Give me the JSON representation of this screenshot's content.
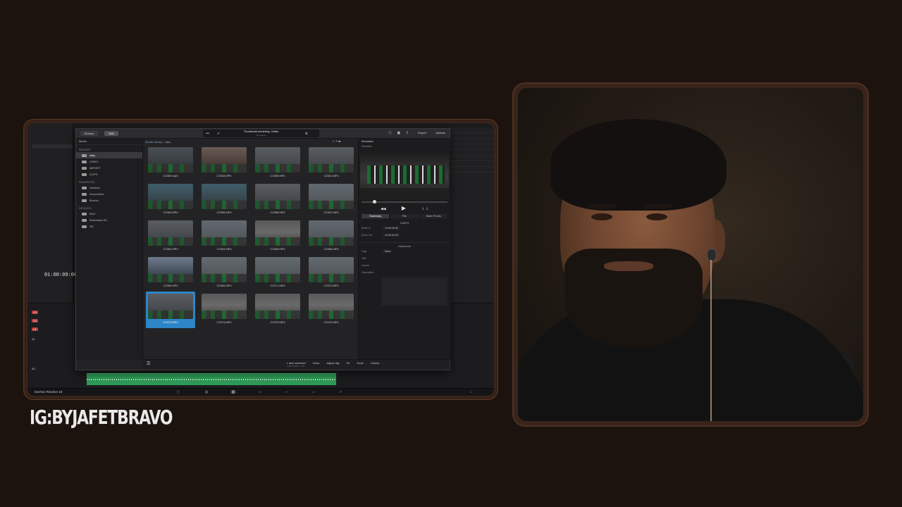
{
  "overlay": {
    "ig_handle": "IG:BYJAFETBRAVO"
  },
  "colors": {
    "page_bg": "#1d130e",
    "frame": "#3a241a",
    "accent": "#2d86c8",
    "audio_green": "#2e9a56"
  },
  "editor": {
    "timecode": "01:00:09:06",
    "status_label": "DaVinci Resolve 18",
    "dialog": {
      "tab_a": "Browse",
      "tab_b": "Grid",
      "title": "Thumbnail rendering: 3 files",
      "subtitle": "On Queue",
      "export_label": "Export",
      "options_label": "Options",
      "sidebar_head": "Media",
      "recent_label": "RECENT",
      "favorites_label": "FAVORITES",
      "devices_label": "DEVICES",
      "recent_folders": [
        "clips",
        "VIDEO",
        "IMPORT",
        "CLIPS"
      ],
      "favorite_folders": [
        "Desktop",
        "Documents",
        "Movies"
      ],
      "device_folders": [
        "MAC",
        "Macintosh HD",
        "SD"
      ],
      "breadcrumb_root": "Media Library",
      "breadcrumb_leaf": "clips",
      "clips": [
        {
          "name": "C2353.mp4",
          "theme": "th1"
        },
        {
          "name": "C2353.MP4",
          "theme": "th2"
        },
        {
          "name": "C2359.MP4",
          "theme": "th3"
        },
        {
          "name": "C2361.MP4",
          "theme": "th3"
        },
        {
          "name": "C2363.MP4",
          "theme": "th4"
        },
        {
          "name": "C2365.MP4",
          "theme": "th4"
        },
        {
          "name": "C2368.MP4",
          "theme": "th3"
        },
        {
          "name": "C2367.MP4",
          "theme": "th5"
        },
        {
          "name": "C2362.MP4",
          "theme": "th3"
        },
        {
          "name": "C2364.MP4",
          "theme": "th5"
        },
        {
          "name": "C2365.MP4",
          "theme": "th7"
        },
        {
          "name": "C2366.MP4",
          "theme": "th5"
        },
        {
          "name": "C2369.MP4",
          "theme": "th6"
        },
        {
          "name": "C2369.MP4",
          "theme": "th5"
        },
        {
          "name": "C2371.MP4",
          "theme": "th5"
        },
        {
          "name": "C2372.MP4",
          "theme": "th5"
        },
        {
          "name": "C2373.MP4",
          "theme": "th3",
          "selected": true
        },
        {
          "name": "C2374.MP4",
          "theme": "th7"
        },
        {
          "name": "C2375.MP4",
          "theme": "th7"
        },
        {
          "name": "C2376.MP4",
          "theme": "th7"
        }
      ],
      "selection_status": "1 item selected",
      "selection_sub": "C2373.MP4 • 1 file",
      "tools": [
        "Clear",
        "Adjust clip",
        "Fit",
        "Tools",
        "Unlock"
      ],
      "metadata": {
        "head": "Metadata",
        "sub": "Preview",
        "tabs": [
          "Summary",
          "File",
          "Mark Points"
        ],
        "clip_title": "C2373",
        "rows": [
          {
            "key": "Mode In",
            "value": "10:06:34:08"
          },
          {
            "key": "Mode Out",
            "value": "10:06:34:28"
          }
        ],
        "section": "Keywords",
        "fields": [
          "Flag",
          "Title",
          "Layout",
          "Description"
        ],
        "flag_value": "None"
      }
    }
  }
}
